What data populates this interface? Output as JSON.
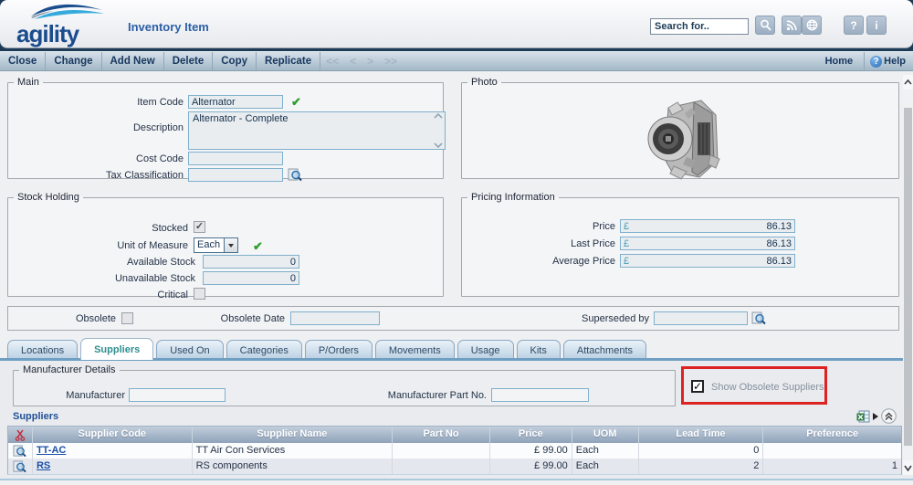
{
  "header": {
    "logo": "agility",
    "title": "Inventory Item",
    "search_value": "Search for..",
    "help_button": "?",
    "info_button": "i"
  },
  "toolbar": {
    "buttons": [
      "Close",
      "Change",
      "Add New",
      "Delete",
      "Copy",
      "Replicate"
    ],
    "nav_buttons": [
      "<<",
      "<",
      ">",
      ">>"
    ],
    "home": "Home",
    "help": "Help"
  },
  "main": {
    "legend": "Main",
    "item_code": {
      "label": "Item Code",
      "value": "Alternator"
    },
    "description": {
      "label": "Description",
      "value": "Alternator - Complete"
    },
    "cost_code": {
      "label": "Cost Code",
      "value": ""
    },
    "tax_classification": {
      "label": "Tax Classification",
      "value": ""
    }
  },
  "photo": {
    "legend": "Photo"
  },
  "stock": {
    "legend": "Stock Holding",
    "stocked_label": "Stocked",
    "uom_label": "Unit of Measure",
    "uom_value": "Each",
    "available_label": "Available Stock",
    "available_value": "0",
    "unavailable_label": "Unavailable Stock",
    "unavailable_value": "0",
    "critical_label": "Critical"
  },
  "pricing": {
    "legend": "Pricing Information",
    "currency": "£",
    "price_label": "Price",
    "price_value": "86.13",
    "last_price_label": "Last Price",
    "last_price_value": "86.13",
    "average_price_label": "Average Price",
    "average_price_value": "86.13"
  },
  "obsolete": {
    "obsolete_label": "Obsolete",
    "date_label": "Obsolete Date",
    "date_value": "",
    "superseded_label": "Superseded by",
    "superseded_value": ""
  },
  "tabs": [
    {
      "label": "Locations",
      "active": false
    },
    {
      "label": "Suppliers",
      "active": true
    },
    {
      "label": "Used On",
      "active": false
    },
    {
      "label": "Categories",
      "active": false
    },
    {
      "label": "P/Orders",
      "active": false
    },
    {
      "label": "Movements",
      "active": false
    },
    {
      "label": "Usage",
      "active": false
    },
    {
      "label": "Kits",
      "active": false
    },
    {
      "label": "Attachments",
      "active": false
    }
  ],
  "manufacturer": {
    "legend": "Manufacturer Details",
    "manufacturer_label": "Manufacturer",
    "manufacturer_value": "",
    "part_no_label": "Manufacturer Part No.",
    "part_no_value": "",
    "show_obsolete_label": "Show Obsolete Suppliers",
    "show_obsolete_checked": true
  },
  "suppliers": {
    "heading": "Suppliers",
    "columns": [
      "Supplier Code",
      "Supplier Name",
      "Part No",
      "Price",
      "UOM",
      "Lead Time",
      "Preference"
    ],
    "rows": [
      {
        "code": "TT-AC",
        "name": "TT Air Con Services",
        "part_no": "",
        "price": "£ 99.00",
        "uom": "Each",
        "lead_time": "0",
        "preference": ""
      },
      {
        "code": "RS",
        "name": "RS components",
        "part_no": "",
        "price": "£ 99.00",
        "uom": "Each",
        "lead_time": "2",
        "preference": "1"
      }
    ]
  },
  "colors": {
    "accent_blue": "#2b5fa6",
    "active_tab_teal": "#2e8f8f",
    "annotation_red": "#dd2222",
    "link_blue": "#1a4fa8"
  }
}
